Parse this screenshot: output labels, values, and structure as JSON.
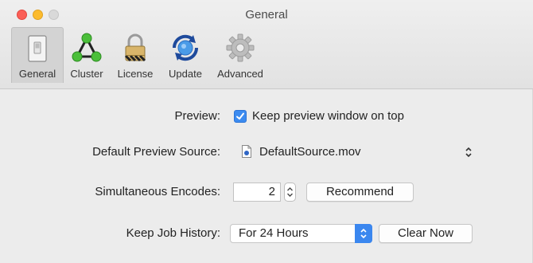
{
  "window": {
    "title": "General"
  },
  "toolbar": {
    "items": [
      {
        "label": "General",
        "icon": "switch-icon",
        "selected": true
      },
      {
        "label": "Cluster",
        "icon": "cluster-icon",
        "selected": false
      },
      {
        "label": "License",
        "icon": "padlock-icon",
        "selected": false
      },
      {
        "label": "Update",
        "icon": "update-globe-icon",
        "selected": false
      },
      {
        "label": "Advanced",
        "icon": "gear-icon",
        "selected": false
      }
    ]
  },
  "preview": {
    "label": "Preview:",
    "checkbox_label": "Keep preview window on top",
    "checked": true
  },
  "default_source": {
    "label": "Default Preview Source:",
    "value": "DefaultSource.mov"
  },
  "simultaneous_encodes": {
    "label": "Simultaneous Encodes:",
    "value": "2",
    "recommend_label": "Recommend"
  },
  "job_history": {
    "label": "Keep Job History:",
    "selected_option": "For 24 Hours",
    "clear_label": "Clear Now"
  },
  "colors": {
    "accent": "#3b87ef",
    "close": "#fb5f57",
    "minimize": "#fcbb2d",
    "maximize_disabled": "#d9d9d9"
  }
}
